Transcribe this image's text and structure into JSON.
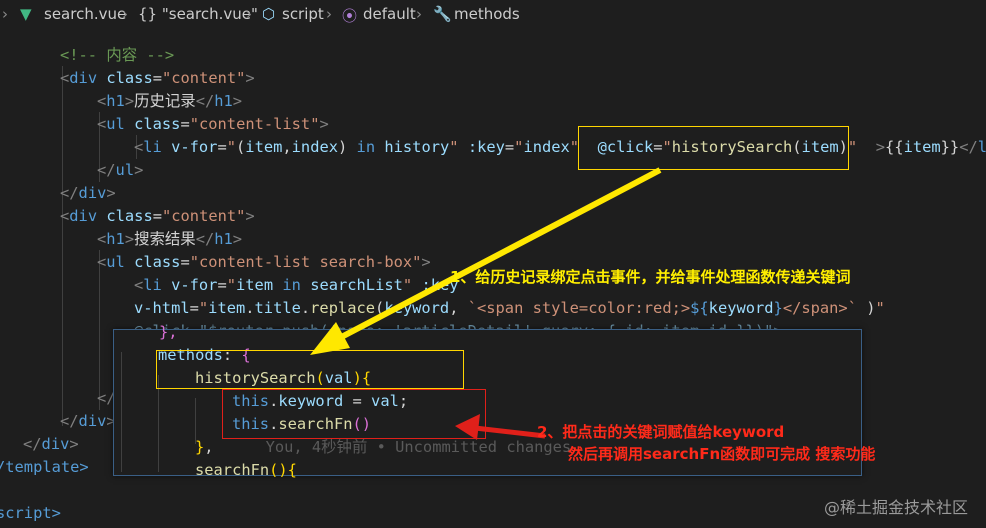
{
  "breadcrumb": {
    "chevron": "›",
    "file": "search.vue",
    "item2": "{} \"search.vue\"",
    "item3": "script",
    "item4": "default",
    "item5": "methods"
  },
  "code": {
    "l1_comment": "<!-- 内容 -->",
    "h1_history": "历史记录",
    "h1_search": "搜索结果",
    "vfor1": "\"(item,index) in history\"",
    "key_attr": "\"index\"",
    "click_attr": "@click=\"historySearch(item)\"",
    "mustache": "{{item}}",
    "vfor2": "\"item in searchList\"",
    "vfor2_key": ":key",
    "vhtml_val": "\"item.title.replace(keyword, `<span style=color:red;>${keyword}</span>` )\"",
    "click2": "@click=\"$router.push({name: 'articleDetail',query: { id: item.id }})\">",
    "tpl_end": "/template>",
    "script": "script>"
  },
  "peek": {
    "line0": "},",
    "methods": "methods: {",
    "historySearch": "historySearch(val){",
    "keyword_assign": "this.keyword = val;",
    "searchFn_call": "this.searchFn()",
    "close_brace": "},",
    "blame": "You, 4秒钟前 • Uncommitted changes",
    "searchFn_def": "searchFn(){"
  },
  "annotations": {
    "one": "1、给历史记录绑定点击事件，并给事件处理函数传递关键词",
    "two_a": "2、把点击的关键词赋值给keyword",
    "two_b": "然后再调用searchFn函数即可完成 搜索功能"
  },
  "watermark": "@稀土掘金技术社区",
  "colors": {
    "annotation_yellow": "#ffef00",
    "annotation_red": "#ff2a1a",
    "editor_bg": "#1e1e1e"
  }
}
